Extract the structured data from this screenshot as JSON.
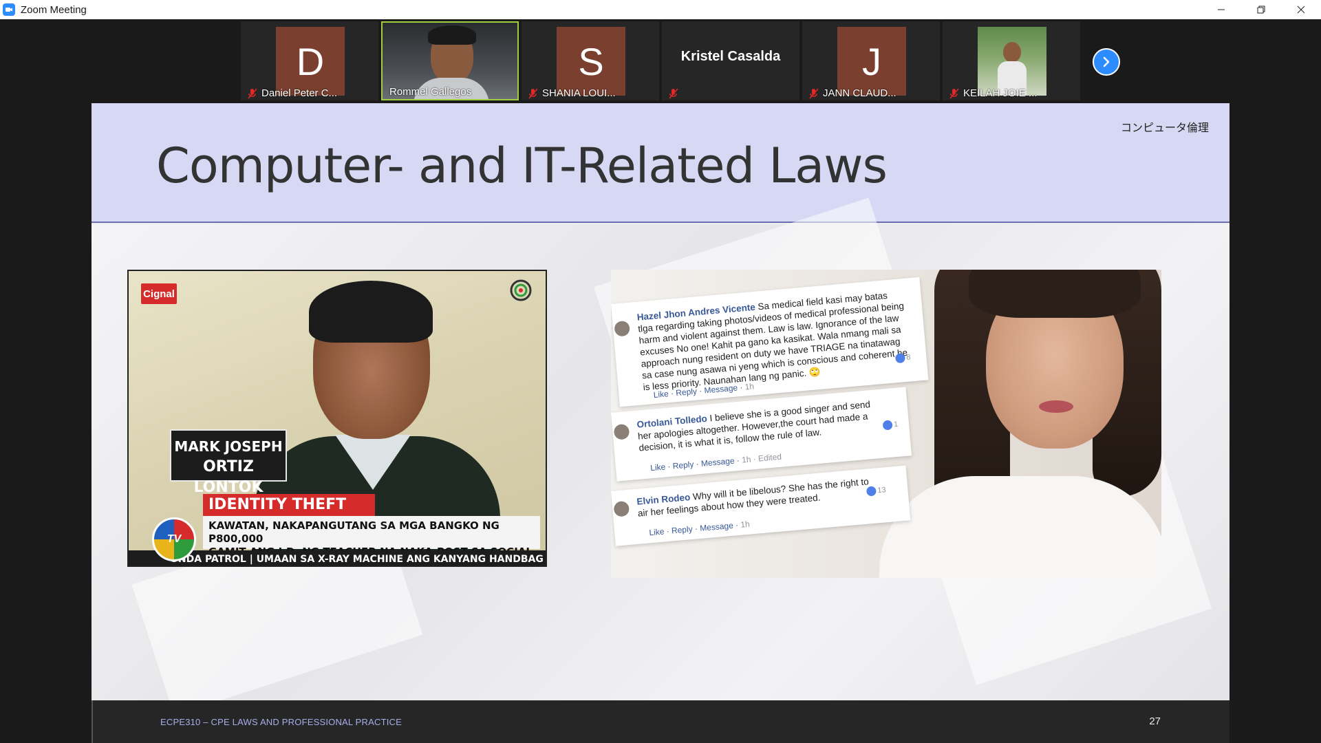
{
  "window": {
    "title": "Zoom Meeting",
    "controls": {
      "minimize": "—",
      "restore": "❐",
      "close": "✕"
    }
  },
  "participants": [
    {
      "initial": "D",
      "name": "Daniel Peter C...",
      "muted": true,
      "video": false
    },
    {
      "initial": "",
      "name": "Rommel Gallegos",
      "muted": false,
      "video": true,
      "active_speaker": true
    },
    {
      "initial": "S",
      "name": "SHANIA LOUI...",
      "muted": true,
      "video": false
    },
    {
      "initial": "",
      "name": "",
      "display_name": "Kristel Casalda",
      "muted": true,
      "video": false
    },
    {
      "initial": "J",
      "name": "JANN CLAUD...",
      "muted": true,
      "video": false
    },
    {
      "initial": "",
      "name": "KEILAH JOIE ...",
      "muted": true,
      "video": true
    }
  ],
  "slide": {
    "tag": "コンピュータ倫理",
    "title": "Computer- and IT-Related Laws",
    "news_image": {
      "channel_logo": "Cignal",
      "nameplate_line1": "MARK JOSEPH",
      "nameplate_line2": "ORTIZ LONTOK",
      "banner": "IDENTITY THEFT",
      "ticker_line1": "KAWATAN, NAKAPANGUTANG SA MGA BANGKO NG P800,000",
      "ticker_line2": "GAMIT ANG I.D. NG TEACHER NA NAKA-POST SA SOCIAL MEDIA",
      "bottom_bar": "ONDA PATROL | UMAAN SA X-RAY MACHINE ANG KANYANG HANDBAG",
      "tv_logo": "TV"
    },
    "comments": [
      {
        "author": "Hazel Jhon Andres Vicente",
        "text": "Sa medical field kasi may batas tlga regarding taking photos/videos of medical professional being harm and violent against them. Law is law. Ignorance of the law excuses No one! Kahit pa gano ka kasikat. Wala nmang mali sa approach nung resident on duty we have TRIAGE na tinatawag sa case nung asawa ni yeng which is conscious and coherent he is less priority. Naunahan lang ng panic. 🙄",
        "actions": [
          "Like",
          "Reply",
          "Message"
        ],
        "time": "1h",
        "reactions": "8"
      },
      {
        "author": "Ortolani Tolledo",
        "text": "I believe she is a good singer and send her apologies altogether. However,the court had made a decision, it is what it is, follow the rule of law.",
        "actions": [
          "Like",
          "Reply",
          "Message"
        ],
        "time": "1h · Edited",
        "reactions": "1"
      },
      {
        "author": "Elvin Rodeo",
        "text": "Why will it be libelous? She has the right to air her feelings about how they were treated.",
        "actions": [
          "Like",
          "Reply",
          "Message"
        ],
        "time": "1h",
        "reactions": "13"
      }
    ],
    "footer": {
      "course": "ECPE310 – CPE LAWS AND PROFESSIONAL PRACTICE",
      "page": "27"
    }
  },
  "colors": {
    "zoom_blue": "#2d8cff",
    "active_border": "#9fcf3f",
    "header_band": "#d6d8f4",
    "avatar_bg": "#7a3f2e",
    "muted_red": "#e02828"
  }
}
